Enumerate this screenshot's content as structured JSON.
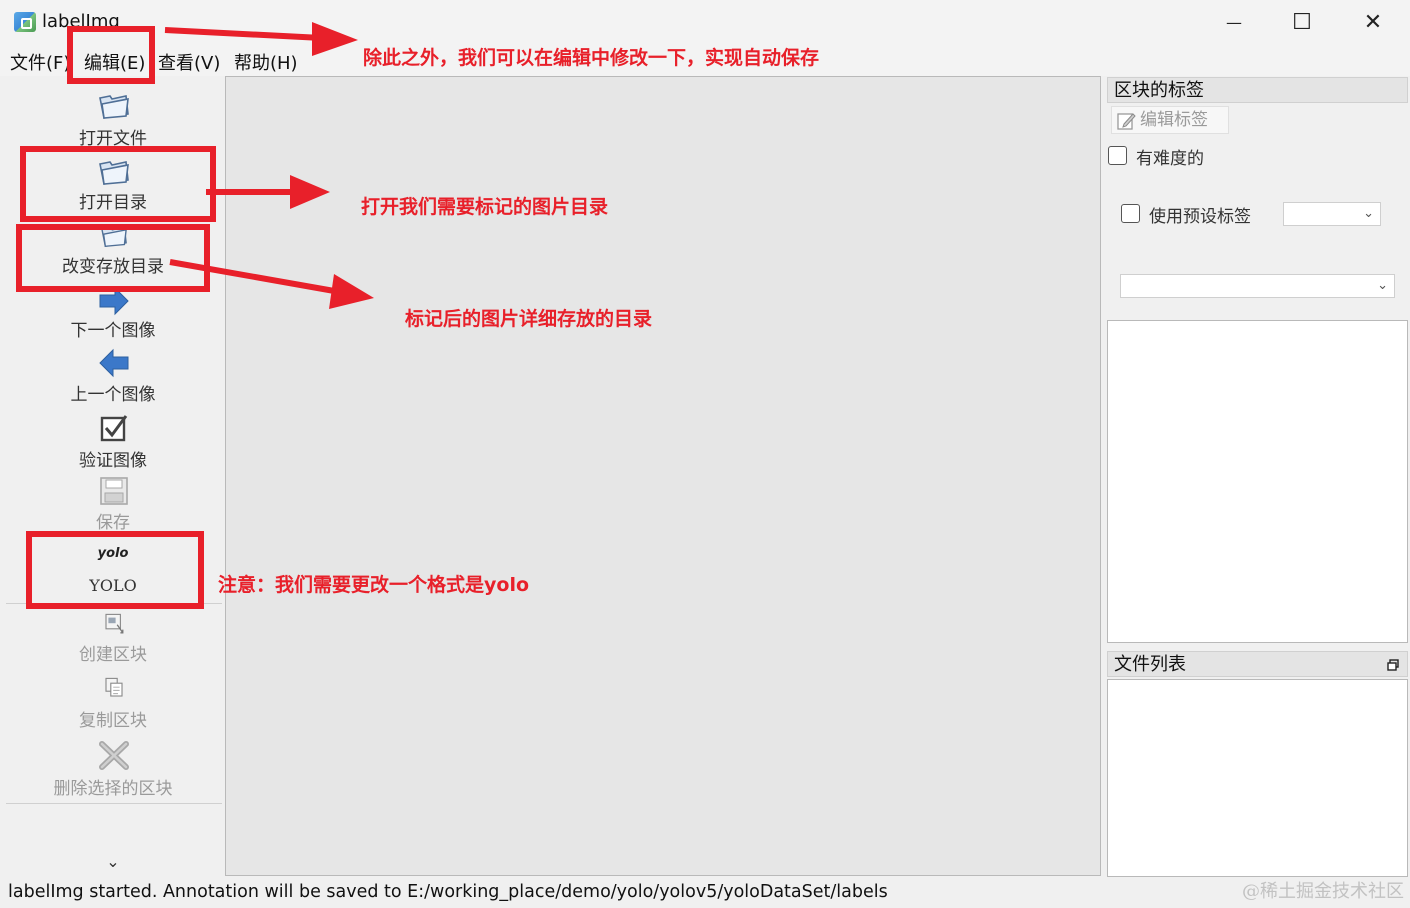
{
  "window": {
    "title": "labelImg",
    "minimize_glyph": "—",
    "maximize_glyph": "☐",
    "close_glyph": "✕"
  },
  "menu": {
    "file": "文件(F)",
    "edit": "编辑(E)",
    "view": "查看(V)",
    "help": "帮助(H)"
  },
  "toolbar": {
    "open_file": "打开文件",
    "open_dir": "打开目录",
    "change_save_dir": "改变存放目录",
    "next_image": "下一个图像",
    "prev_image": "上一个图像",
    "verify_image": "验证图像",
    "save": "保存",
    "format_icon_text": "yolo",
    "format": "YOLO",
    "create_box": "创建区块",
    "duplicate_box": "复制区块",
    "delete_box": "删除选择的区块",
    "more_glyph": "⌄"
  },
  "dock": {
    "box_labels_title": "区块的标签",
    "edit_label": "编辑标签",
    "difficult": "有难度的",
    "use_default_label": "使用预设标签",
    "file_list_title": "文件列表"
  },
  "status": {
    "message": "labelImg started. Annotation will be saved to E:/working_place/demo/yolo/yolov5/yoloDataSet/labels",
    "watermark": "@稀土掘金技术社区"
  },
  "annotations": {
    "edit_note": "除此之外，我们可以在编辑中修改一下，实现自动保存",
    "open_dir_note": "打开我们需要标记的图片目录",
    "save_dir_note": "标记后的图片详细存放的目录",
    "format_note": "注意：我们需要更改一个格式是yolo"
  },
  "colors": {
    "annotation_red": "#e8202a",
    "canvas_bg": "#e6e6e6",
    "arrow_blue": "#3b78c9"
  }
}
